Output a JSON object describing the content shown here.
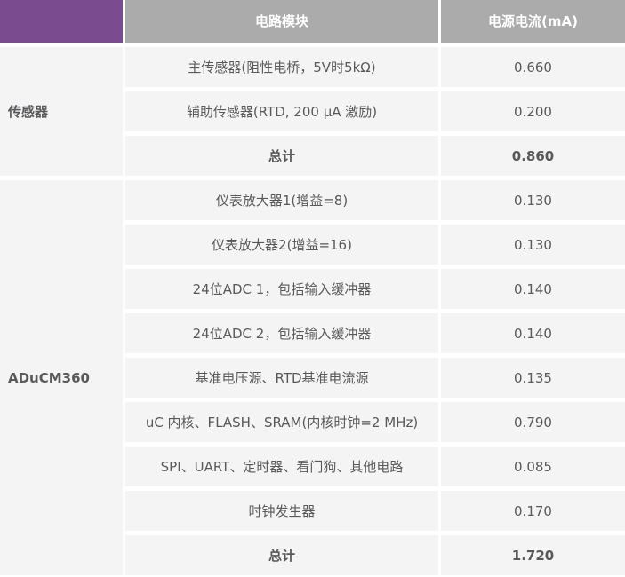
{
  "table": {
    "header": {
      "module_col": "电路模块",
      "current_col": "电源电流(mA)"
    },
    "sections": [
      {
        "label": "传感器",
        "rows": [
          {
            "module": "主传感器(阻性电桥，5V时5kΩ)",
            "current": "0.660"
          },
          {
            "module": "辅助传感器(RTD, 200 μA 激励)",
            "current": "0.200"
          },
          {
            "module": "总计",
            "current": "0.860"
          }
        ]
      },
      {
        "label": "ADuCM360",
        "rows": [
          {
            "module": "仪表放大器1(增益=8)",
            "current": "0.130"
          },
          {
            "module": "仪表放大器2(增益=16)",
            "current": "0.130"
          },
          {
            "module": "24位ADC 1，包括输入缓冲器",
            "current": "0.140"
          },
          {
            "module": "24位ADC 2，包括输入缓冲器",
            "current": "0.140"
          },
          {
            "module": "基准电压源、RTD基准电流源",
            "current": "0.135"
          },
          {
            "module": "uC 内核、FLASH、SRAM(内核时钟=2 MHz)",
            "current": "0.790"
          },
          {
            "module": "SPI、UART、定时器、看门狗、其他电路",
            "current": "0.085"
          },
          {
            "module": "时钟发生器",
            "current": "0.170"
          },
          {
            "module": "总计",
            "current": "1.720"
          }
        ]
      }
    ]
  },
  "chart_data": {
    "type": "table",
    "title": "",
    "columns": [
      "电路模块",
      "电源电流(mA)"
    ],
    "groups": [
      {
        "group": "传感器",
        "rows": [
          [
            "主传感器(阻性电桥，5V时5kΩ)",
            0.66
          ],
          [
            "辅助传感器(RTD, 200 μA 激励)",
            0.2
          ],
          [
            "总计",
            0.86
          ]
        ]
      },
      {
        "group": "ADuCM360",
        "rows": [
          [
            "仪表放大器1(增益=8)",
            0.13
          ],
          [
            "仪表放大器2(增益=16)",
            0.13
          ],
          [
            "24位ADC 1，包括输入缓冲器",
            0.14
          ],
          [
            "24位ADC 2，包括输入缓冲器",
            0.14
          ],
          [
            "基准电压源、RTD基准电流源",
            0.135
          ],
          [
            "uC 内核、FLASH、SRAM(内核时钟=2 MHz)",
            0.79
          ],
          [
            "SPI、UART、定时器、看门狗、其他电路",
            0.085
          ],
          [
            "时钟发生器",
            0.17
          ],
          [
            "总计",
            1.72
          ]
        ]
      }
    ]
  },
  "colors": {
    "header_purple": "#7B4B8F",
    "header_gray": "#ABABAB",
    "row_bg": "#F4F4F4",
    "text": "#58595B"
  }
}
